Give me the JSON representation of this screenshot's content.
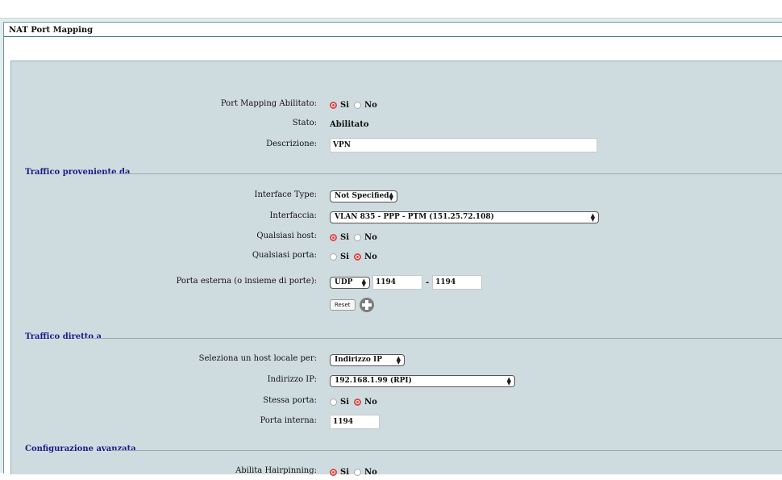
{
  "window": {
    "title": "NAT Port Mapping"
  },
  "general": {
    "enabled_label": "Port Mapping Abilitato:",
    "enabled_yes": "Si",
    "enabled_no": "No",
    "enabled_value": "Si",
    "status_label": "Stato:",
    "status_value": "Abilitato",
    "description_label": "Descrizione:",
    "description_value": "VPN"
  },
  "source": {
    "heading": "Traffico proveniente da",
    "interface_type_label": "Interface Type:",
    "interface_type_value": "Not Specified",
    "interface_label": "Interfaccia:",
    "interface_value": "VLAN 835 - PPP - PTM (151.25.72.108)",
    "any_host_label": "Qualsiasi host:",
    "any_host_yes": "Si",
    "any_host_no": "No",
    "any_host_value": "Si",
    "any_port_label": "Qualsiasi porta:",
    "any_port_yes": "Si",
    "any_port_no": "No",
    "any_port_value": "No",
    "ext_port_label": "Porta esterna (o insieme di porte):",
    "protocol_value": "UDP",
    "port_from": "1194",
    "port_separator": "-",
    "port_to": "1194",
    "reset_label": "Reset"
  },
  "destination": {
    "heading": "Traffico diretto a",
    "host_select_label": "Seleziona un host locale per:",
    "host_select_value": "Indirizzo IP",
    "ip_label": "Indirizzo IP:",
    "ip_value": "192.168.1.99 (RPI)",
    "same_port_label": "Stessa porta:",
    "same_port_yes": "Si",
    "same_port_no": "No",
    "same_port_value": "No",
    "internal_port_label": "Porta interna:",
    "internal_port_value": "1194"
  },
  "advanced": {
    "heading": "Configurazione avanzata",
    "hairpin_label": "Abilita Hairpinning:",
    "hairpin_yes": "Si",
    "hairpin_no": "No",
    "hairpin_value": "Si"
  },
  "colors": {
    "accent": "#2f6e7a",
    "radio_on": "#d94a4a",
    "section_heading": "#1b1b8a",
    "panel": "#cfdcdf"
  }
}
